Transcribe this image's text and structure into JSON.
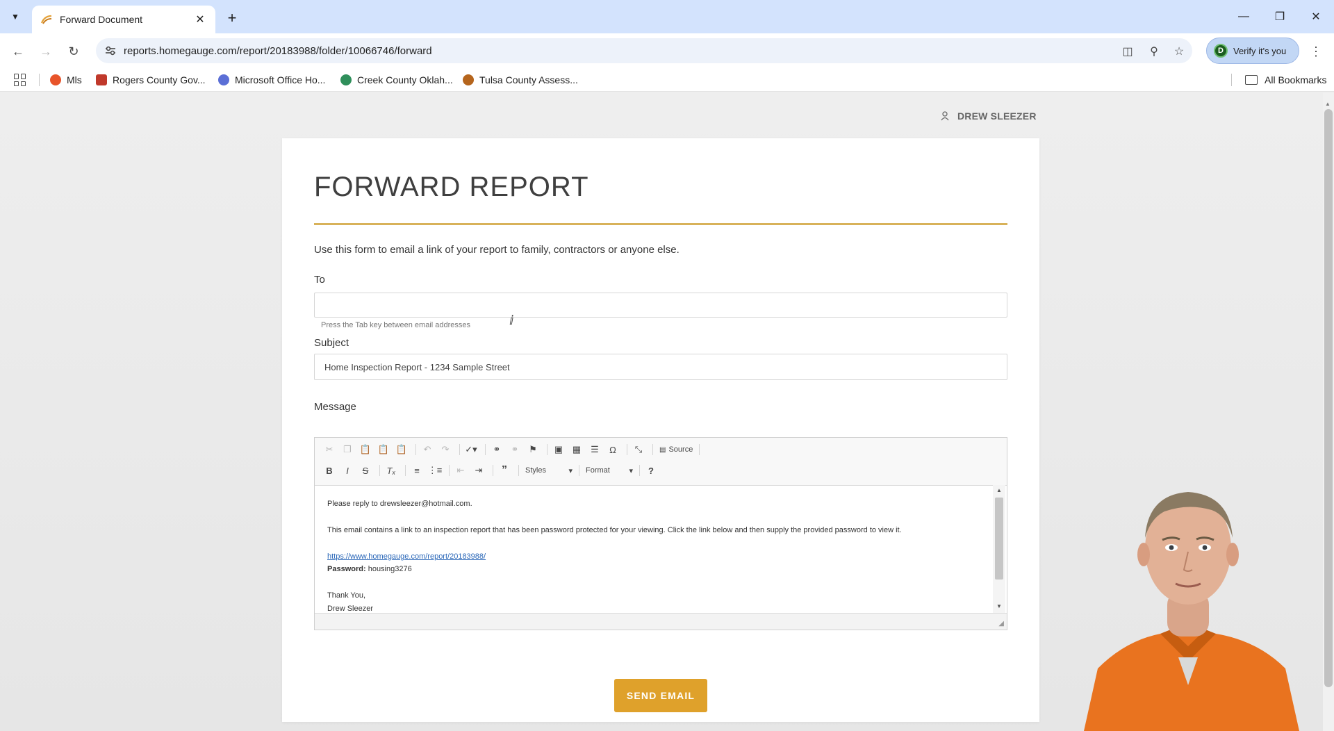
{
  "browser": {
    "tab": {
      "title": "Forward Document"
    },
    "url": "reports.homegauge.com/report/20183988/folder/10066746/forward",
    "verify_label": "Verify it's you",
    "verify_avatar": "D",
    "bookmarks": [
      {
        "label": "Mls",
        "color": "#e8542a"
      },
      {
        "label": "Rogers County Gov...",
        "color": "#c0392b"
      },
      {
        "label": "Microsoft Office Ho...",
        "color": "#5b6fd6"
      },
      {
        "label": "Creek County Oklah...",
        "color": "#2f8f5b"
      },
      {
        "label": "Tulsa County Assess...",
        "color": "#b5651d"
      }
    ],
    "all_bookmarks_label": "All Bookmarks"
  },
  "page": {
    "user_name": "DREW SLEEZER",
    "title": "FORWARD REPORT",
    "intro": "Use this form to email a link of your report to family, contractors or anyone else.",
    "to_label": "To",
    "to_value": "",
    "to_hint": "Press the Tab key between email addresses",
    "subject_label": "Subject",
    "subject_value": "Home Inspection Report - 1234 Sample Street",
    "message_label": "Message",
    "editor": {
      "styles_label": "Styles",
      "format_label": "Format",
      "source_label": "Source",
      "help_label": "?"
    },
    "message": {
      "line1": "Please reply to drewsleezer@hotmail.com.",
      "line2": "This email contains a link to an inspection report that has been password protected for your viewing. Click the link below and then supply the provided password to view it.",
      "link": "https://www.homegauge.com/report/20183988/",
      "password_label": "Password:",
      "password_value": "housing3276",
      "closing": "Thank You,",
      "signature": "Drew Sleezer"
    },
    "send_label": "SEND EMAIL"
  },
  "colors": {
    "accent_rule": "#d8b25a",
    "send_button": "#dfa12b",
    "tabstrip": "#d3e3fd"
  }
}
